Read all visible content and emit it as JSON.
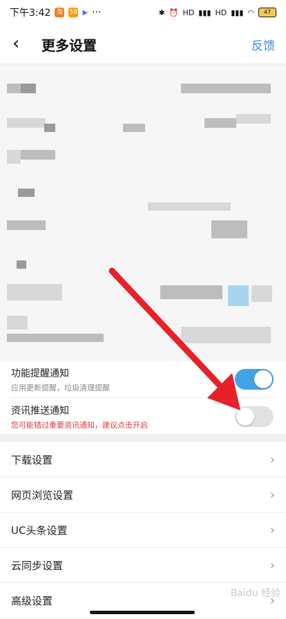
{
  "status_bar": {
    "time": "下午3:42",
    "app1": "淘",
    "app2": "58",
    "more": "···",
    "signal1": "HD",
    "signal2": "HD",
    "battery": "47"
  },
  "header": {
    "back_icon": "chevron-left-icon",
    "title": "更多设置",
    "feedback": "反馈"
  },
  "toggles": [
    {
      "title": "功能提醒通知",
      "desc": "应用更新提醒，垃圾清理提醒",
      "on": true
    },
    {
      "title": "资讯推送通知",
      "warning": "您可能错过重要资讯通知，建议点击开启",
      "on": false
    }
  ],
  "menu": [
    {
      "label": "下载设置"
    },
    {
      "label": "网页浏览设置"
    },
    {
      "label": "UC头条设置"
    },
    {
      "label": "云同步设置"
    },
    {
      "label": "高级设置"
    }
  ],
  "colors": {
    "accent": "#3d8de0",
    "toggle_on": "#42a3e6",
    "warning": "#e53a3a",
    "arrow": "#e8202a"
  }
}
